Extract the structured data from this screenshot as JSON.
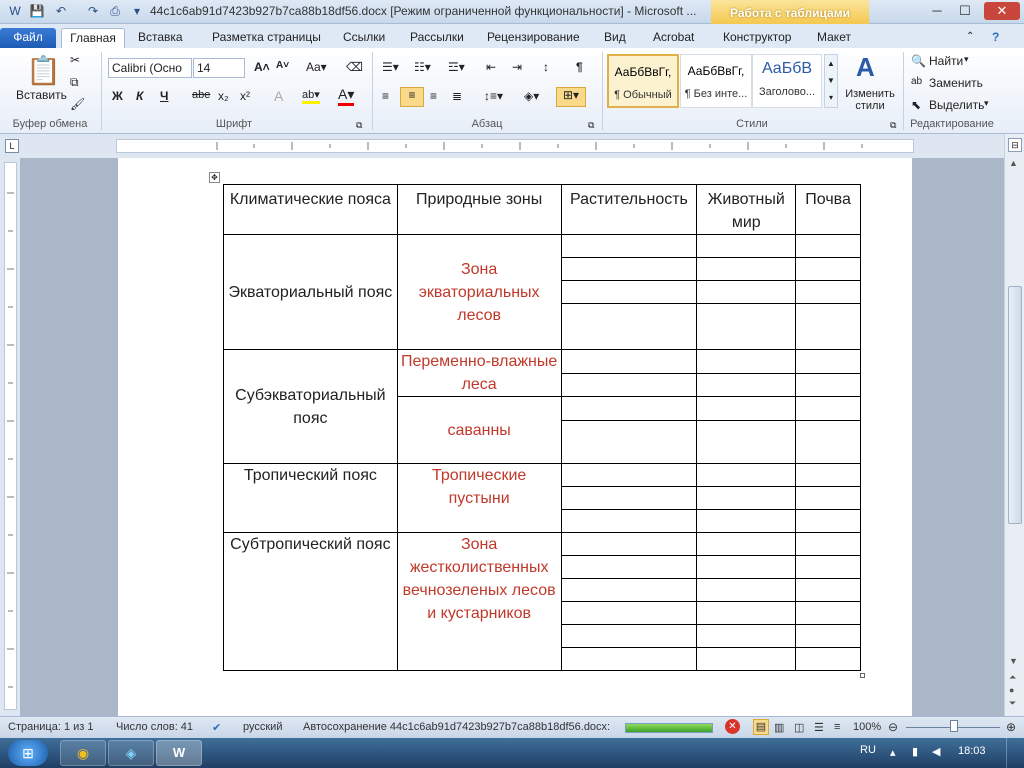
{
  "window": {
    "title": "44c1c6ab91d7423b927b7ca88b18df56.docx [Режим ограниченной функциональности]  -  Microsoft ...",
    "context_tab": "Работа с таблицами",
    "min": "─",
    "max": "☐",
    "close": "✕"
  },
  "tabs": [
    "Файл",
    "Главная",
    "Вставка",
    "Разметка страницы",
    "Ссылки",
    "Рассылки",
    "Рецензирование",
    "Вид",
    "Acrobat",
    "Конструктор",
    "Макет"
  ],
  "ribbon": {
    "clipboard": {
      "paste": "Вставить",
      "label": "Буфер обмена"
    },
    "font": {
      "name": "Calibri (Осно",
      "size": "14",
      "label": "Шрифт"
    },
    "paragraph": {
      "label": "Абзац"
    },
    "styles": {
      "items": [
        {
          "sample": "АаБбВвГг,",
          "name": "¶ Обычный"
        },
        {
          "sample": "АаБбВвГг,",
          "name": "¶ Без инте..."
        },
        {
          "sample": "АаБбВ",
          "name": "Заголово..."
        }
      ],
      "change": "Изменить стили",
      "label": "Стили"
    },
    "editing": {
      "find": "Найти",
      "replace": "Заменить",
      "select": "Выделить",
      "label": "Редактирование"
    }
  },
  "table": {
    "headers": [
      "Климатические пояса",
      "Природные зоны",
      "Растительность",
      "Животный мир",
      "Почва"
    ],
    "belts": [
      {
        "belt": "Экваториальный пояс",
        "zones": [
          "Зона экваториальных лесов"
        ]
      },
      {
        "belt": "Субэкваториальный пояс",
        "zones": [
          "Переменно-влажные леса",
          "саванны"
        ]
      },
      {
        "belt": "Тропический пояс",
        "zones": [
          "Тропические пустыни"
        ]
      },
      {
        "belt": "Субтропический пояс",
        "zones": [
          "Зона жестколиственных вечнозеленых лесов и кустарников"
        ]
      }
    ]
  },
  "status": {
    "page": "Страница: 1 из 1",
    "words": "Число слов: 41",
    "lang": "русский",
    "autosave": "Автосохранение 44c1c6ab91d7423b927b7ca88b18df56.docx:",
    "zoom": "100%"
  },
  "taskbar": {
    "lang": "RU",
    "time": "18:03"
  }
}
